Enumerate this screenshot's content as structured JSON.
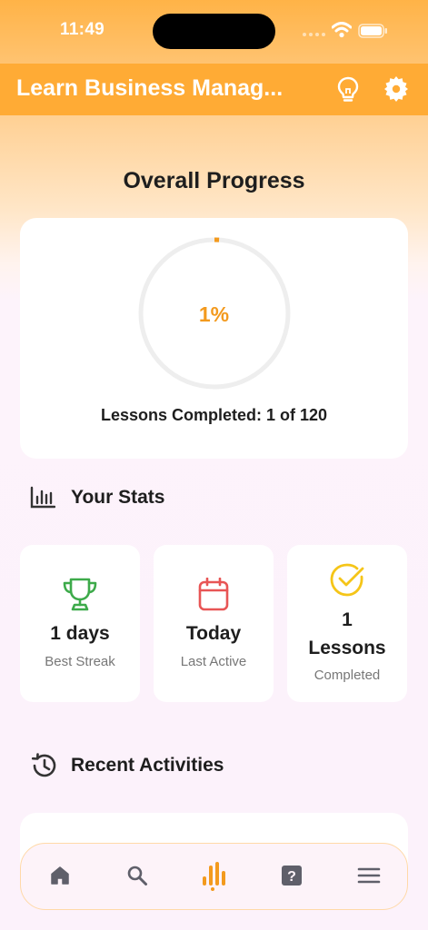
{
  "status_bar": {
    "time": "11:49"
  },
  "header": {
    "title": "Learn Business Manag..."
  },
  "progress": {
    "section_title": "Overall Progress",
    "percent_text": "1%",
    "fraction_completed": 0.01,
    "lessons_completed_text": "Lessons Completed: 1 of 120"
  },
  "stats": {
    "title": "Your Stats",
    "cards": [
      {
        "icon": "trophy-icon",
        "value": "1 days",
        "label": "Best Streak",
        "color": "#3daa4a"
      },
      {
        "icon": "calendar-icon",
        "value": "Today",
        "label": "Last Active",
        "color": "#e85555"
      },
      {
        "icon": "check-circle-icon",
        "value_line1": "1",
        "value_line2": "Lessons",
        "label": "Completed",
        "color": "#f5c518"
      }
    ]
  },
  "recent": {
    "title": "Recent Activities"
  },
  "tab_bar": {
    "active_index": 2,
    "tabs": [
      {
        "icon": "home-icon"
      },
      {
        "icon": "search-icon"
      },
      {
        "icon": "stats-icon"
      },
      {
        "icon": "quiz-icon"
      },
      {
        "icon": "menu-icon"
      }
    ]
  },
  "colors": {
    "accent": "#ffab35",
    "progress": "#f39a1e",
    "background": "#fcf2fb"
  }
}
